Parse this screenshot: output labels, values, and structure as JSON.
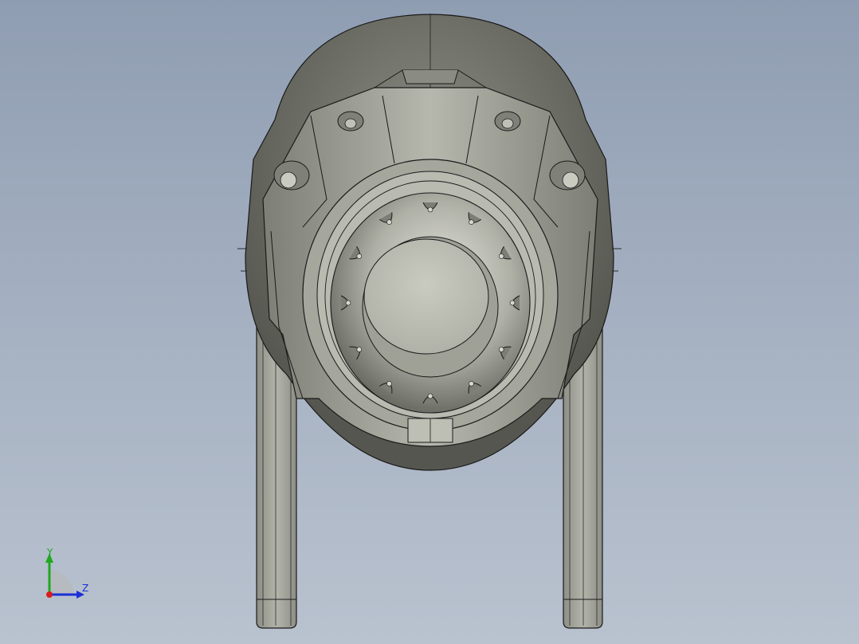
{
  "viewport": {
    "background_top": "#8f9db2",
    "background_bottom": "#b9c2cf",
    "model_color": "#9c9d94",
    "edge_color": "#1a1a1a"
  },
  "triad": {
    "y_label": "Y",
    "z_label": "Z",
    "y_color": "#1fa81f",
    "z_color": "#1b2fd8",
    "x_color": "#d81b1b"
  }
}
